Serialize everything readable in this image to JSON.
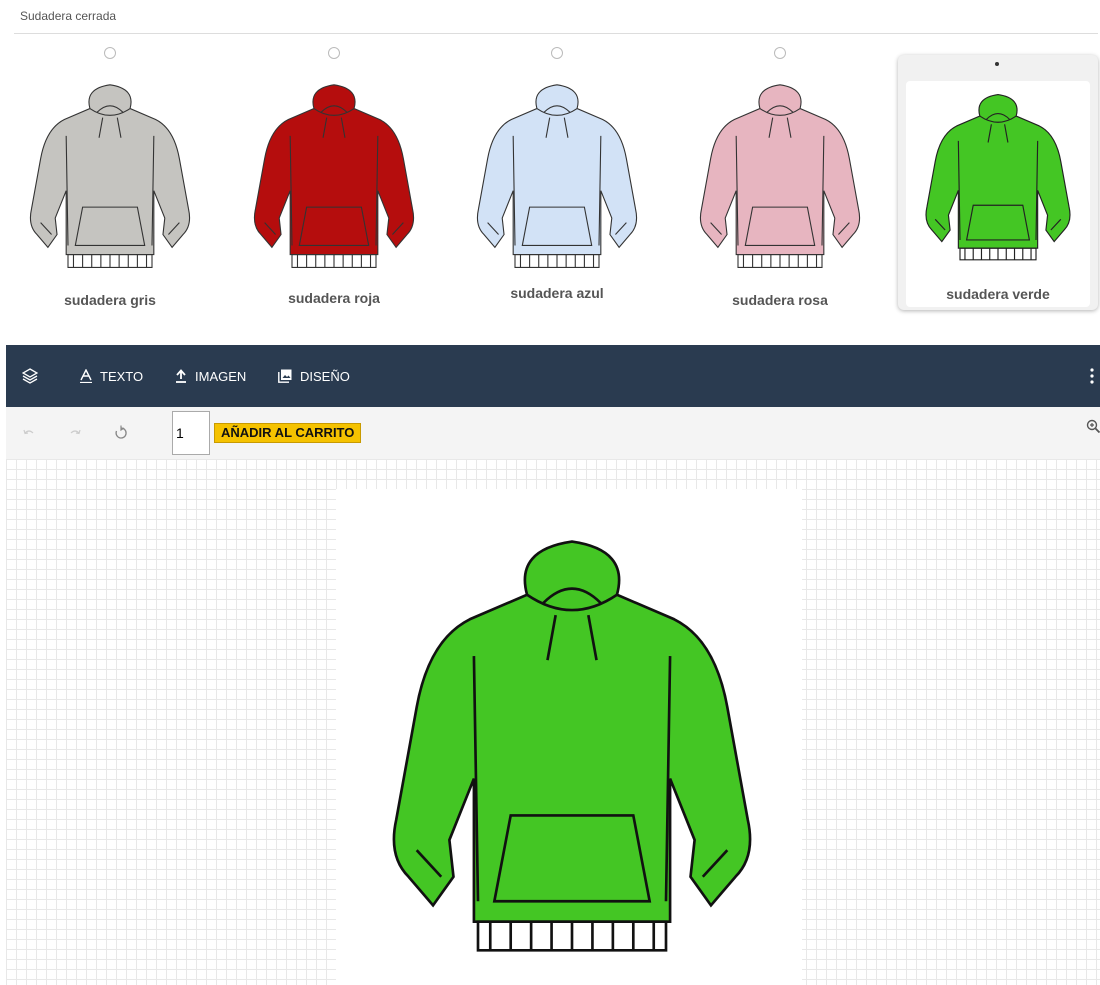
{
  "section": {
    "title": "Sudadera cerrada"
  },
  "variants": [
    {
      "label": "sudadera gris",
      "color": "#c5c4c0",
      "selected": false
    },
    {
      "label": "sudadera roja",
      "color": "#b50d0d",
      "selected": false
    },
    {
      "label": "sudadera azul",
      "color": "#d2e2f6",
      "selected": false
    },
    {
      "label": "sudadera rosa",
      "color": "#e7b5c0",
      "selected": false
    },
    {
      "label": "sudadera verde",
      "color": "#44c624",
      "selected": true
    }
  ],
  "toolbar": {
    "layers_icon": "layers-icon",
    "text_label": "TEXTO",
    "image_label": "IMAGEN",
    "design_label": "DISEÑO",
    "background": "#2a3b50"
  },
  "actions": {
    "quantity": "1",
    "add_to_cart_label": "AÑADIR AL CARRITO",
    "add_to_cart_color": "#f5c200"
  },
  "canvas": {
    "product_color": "#44c624"
  }
}
